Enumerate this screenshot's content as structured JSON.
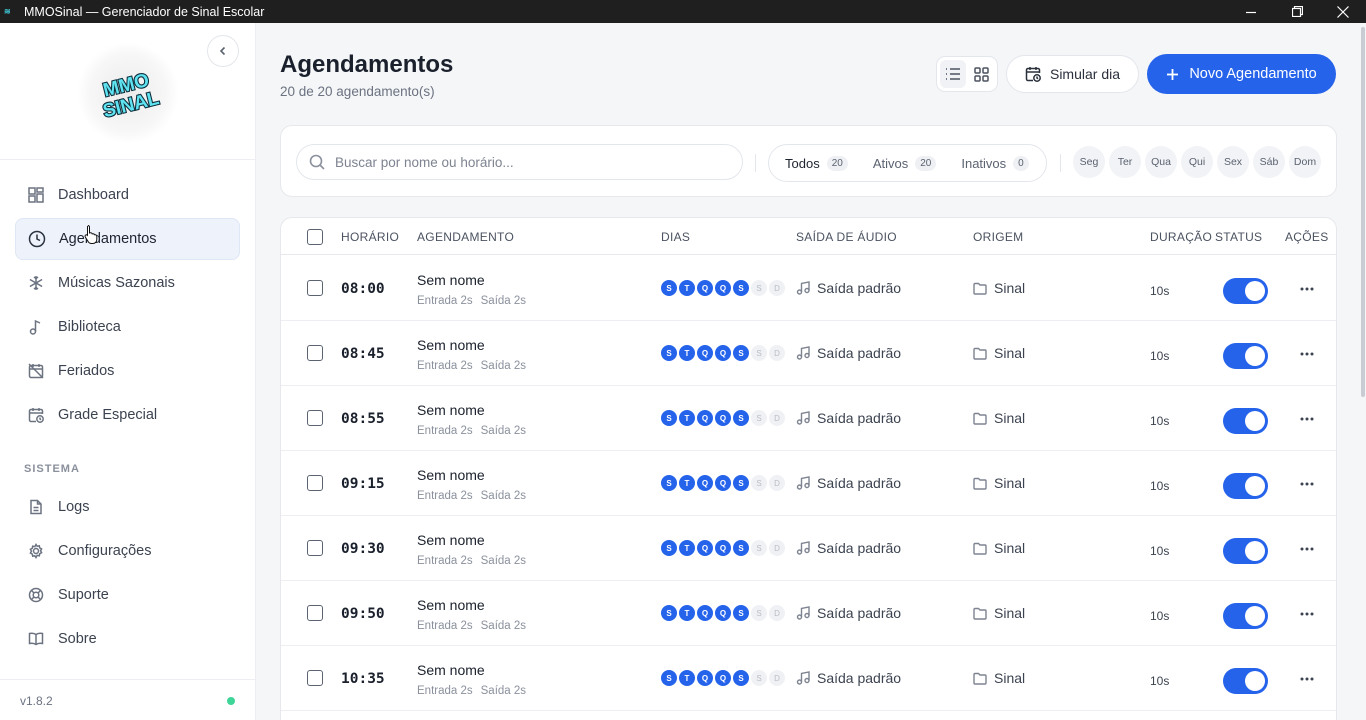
{
  "window": {
    "title": "MMOSinal — Gerenciador de Sinal Escolar"
  },
  "sidebar": {
    "logo_text": "MMO SINAL",
    "items": [
      {
        "label": "Dashboard",
        "icon": "dashboard-icon"
      },
      {
        "label": "Agendamentos",
        "icon": "clock-icon",
        "active": true
      },
      {
        "label": "Músicas Sazonais",
        "icon": "snowflake-icon"
      },
      {
        "label": "Biblioteca",
        "icon": "music-note-icon"
      },
      {
        "label": "Feriados",
        "icon": "calendar-off-icon"
      },
      {
        "label": "Grade Especial",
        "icon": "calendar-clock-icon"
      }
    ],
    "section_label": "SISTEMA",
    "system_items": [
      {
        "label": "Logs",
        "icon": "document-icon"
      },
      {
        "label": "Configurações",
        "icon": "gear-icon"
      },
      {
        "label": "Suporte",
        "icon": "lifebuoy-icon"
      },
      {
        "label": "Sobre",
        "icon": "book-icon"
      }
    ],
    "version": "v1.8.2",
    "status_color": "#3ed598"
  },
  "header": {
    "title": "Agendamentos",
    "subtitle": "20 de 20 agendamento(s)",
    "simulate_label": "Simular dia",
    "new_label": "Novo Agendamento",
    "accent_color": "#2563eb"
  },
  "filters": {
    "search_placeholder": "Buscar por nome ou horário...",
    "segments": [
      {
        "label": "Todos",
        "count": "20",
        "active": true
      },
      {
        "label": "Ativos",
        "count": "20"
      },
      {
        "label": "Inativos",
        "count": "0"
      }
    ],
    "days": [
      "Seg",
      "Ter",
      "Qua",
      "Qui",
      "Sex",
      "Sáb",
      "Dom"
    ]
  },
  "table": {
    "columns": {
      "time": "HORÁRIO",
      "name": "AGENDAMENTO",
      "days": "DIAS",
      "audio": "SAÍDA DE ÁUDIO",
      "origin": "ORIGEM",
      "duration": "DURAÇÃO",
      "status": "STATUS",
      "actions": "AÇÕES"
    },
    "day_letters": [
      "S",
      "T",
      "Q",
      "Q",
      "S",
      "S",
      "D"
    ],
    "rows": [
      {
        "time": "08:00",
        "name": "Sem nome",
        "fade_in": "Entrada 2s",
        "fade_out": "Saída 2s",
        "days_on": [
          1,
          1,
          1,
          1,
          1,
          0,
          0
        ],
        "audio": "Saída padrão",
        "origin": "Sinal",
        "duration": "10s",
        "enabled": true
      },
      {
        "time": "08:45",
        "name": "Sem nome",
        "fade_in": "Entrada 2s",
        "fade_out": "Saída 2s",
        "days_on": [
          1,
          1,
          1,
          1,
          1,
          0,
          0
        ],
        "audio": "Saída padrão",
        "origin": "Sinal",
        "duration": "10s",
        "enabled": true
      },
      {
        "time": "08:55",
        "name": "Sem nome",
        "fade_in": "Entrada 2s",
        "fade_out": "Saída 2s",
        "days_on": [
          1,
          1,
          1,
          1,
          1,
          0,
          0
        ],
        "audio": "Saída padrão",
        "origin": "Sinal",
        "duration": "10s",
        "enabled": true
      },
      {
        "time": "09:15",
        "name": "Sem nome",
        "fade_in": "Entrada 2s",
        "fade_out": "Saída 2s",
        "days_on": [
          1,
          1,
          1,
          1,
          1,
          0,
          0
        ],
        "audio": "Saída padrão",
        "origin": "Sinal",
        "duration": "10s",
        "enabled": true
      },
      {
        "time": "09:30",
        "name": "Sem nome",
        "fade_in": "Entrada 2s",
        "fade_out": "Saída 2s",
        "days_on": [
          1,
          1,
          1,
          1,
          1,
          0,
          0
        ],
        "audio": "Saída padrão",
        "origin": "Sinal",
        "duration": "10s",
        "enabled": true
      },
      {
        "time": "09:50",
        "name": "Sem nome",
        "fade_in": "Entrada 2s",
        "fade_out": "Saída 2s",
        "days_on": [
          1,
          1,
          1,
          1,
          1,
          0,
          0
        ],
        "audio": "Saída padrão",
        "origin": "Sinal",
        "duration": "10s",
        "enabled": true
      },
      {
        "time": "10:35",
        "name": "Sem nome",
        "fade_in": "Entrada 2s",
        "fade_out": "Saída 2s",
        "days_on": [
          1,
          1,
          1,
          1,
          1,
          0,
          0
        ],
        "audio": "Saída padrão",
        "origin": "Sinal",
        "duration": "10s",
        "enabled": true
      }
    ]
  }
}
